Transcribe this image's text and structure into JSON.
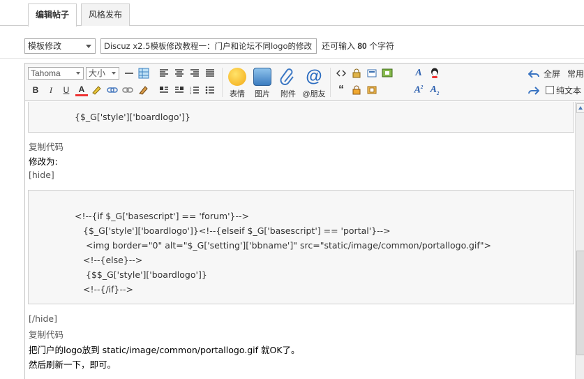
{
  "tabs": [
    {
      "label": "编辑帖子",
      "active": true
    },
    {
      "label": "风格发布",
      "active": false
    }
  ],
  "titlebar": {
    "type_select": "模板修改",
    "subject": "Discuz x2.5模板修改教程一：门户和论坛不同logo的修改",
    "counter_prefix": "还可输入",
    "counter_value": "80",
    "counter_suffix": "个字符"
  },
  "toolbar": {
    "font": "Tahoma",
    "size": "大小",
    "emoticon_label": "表情",
    "image_label": "图片",
    "attach_label": "附件",
    "at_label": "@朋友",
    "fullscreen_label": "全屏",
    "common_label": "常用",
    "plaintext_label": "纯文本",
    "small_buttons": [
      "B",
      "I",
      "U",
      "A"
    ]
  },
  "content": {
    "code1": "{$_G['style']['boardlogo']}",
    "copy1": "复制代码",
    "modify": "修改为:",
    "hide_open": "[hide]",
    "code2": [
      "<!--{if $_G['basescript'] == 'forum'}-->",
      "{$_G['style']['boardlogo']}<!--{elseif $_G['basescript'] == 'portal'}-->",
      "<img border=\"0\" alt=\"$_G['setting']['bbname']\" src=\"static/image/common/portallogo.gif\">",
      "<!--{else}-->",
      "{$$_G['style']['boardlogo']}",
      "<!--{/if}-->"
    ],
    "hide_close": "[/hide]",
    "copy2": "复制代码",
    "line1": "把门户的logo放到  static/image/common/portallogo.gif  就OK了。",
    "line2": "然后刷新一下，即可。"
  },
  "colors": {
    "accent": "#2b5fae",
    "tab_border": "#cdcdcd",
    "code_bg": "#f7f7f7"
  }
}
